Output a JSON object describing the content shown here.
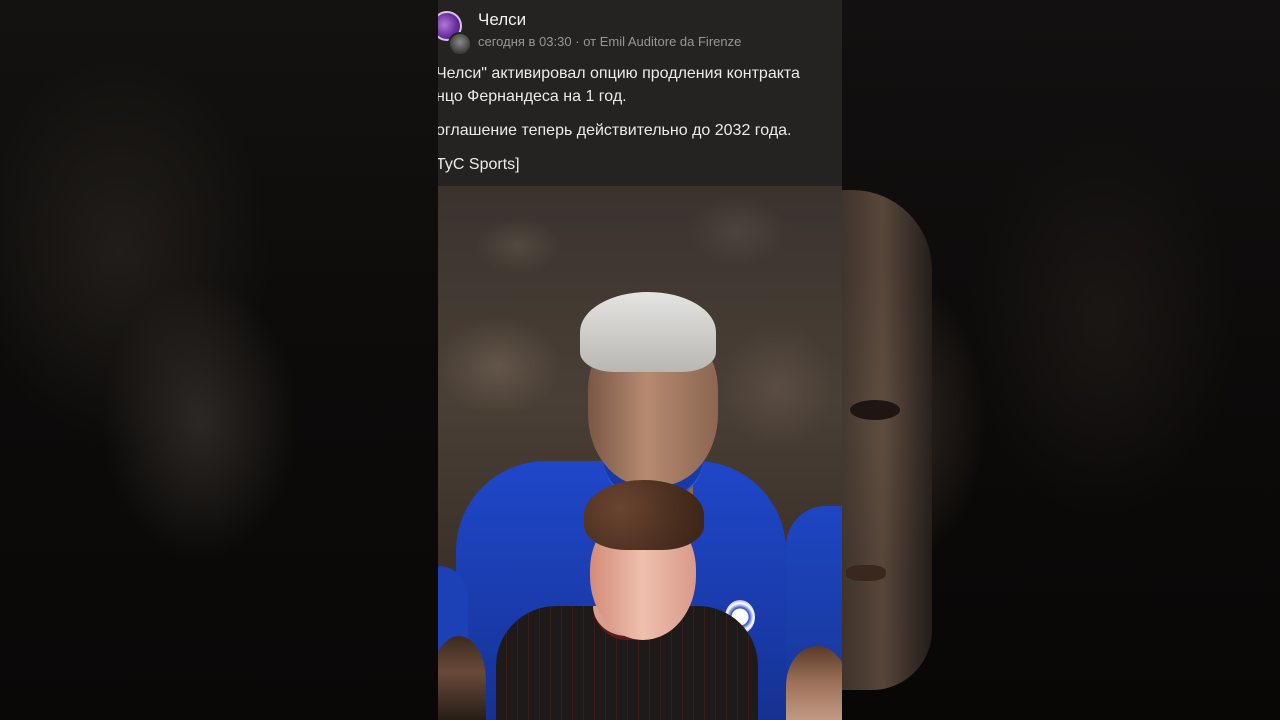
{
  "post": {
    "channel_name": "Челси",
    "date": "сегодня в 03:30",
    "separator": "·",
    "author_line": "от Emil Auditore da Firenze",
    "paragraphs": [
      "Челси\" активировал опцию продления контракта",
      "нцо Фернандеса на 1 год.",
      "оглашение теперь действительно до 2032 года.",
      "TyC Sports]"
    ]
  },
  "colors": {
    "header_bg": "#252321",
    "text_primary": "#ecebe9",
    "text_secondary": "#9a9591",
    "kit_blue": "#1f47c9"
  },
  "icons": {
    "channel_avatar": "channel-avatar-icon",
    "author_avatar": "author-avatar-icon"
  }
}
